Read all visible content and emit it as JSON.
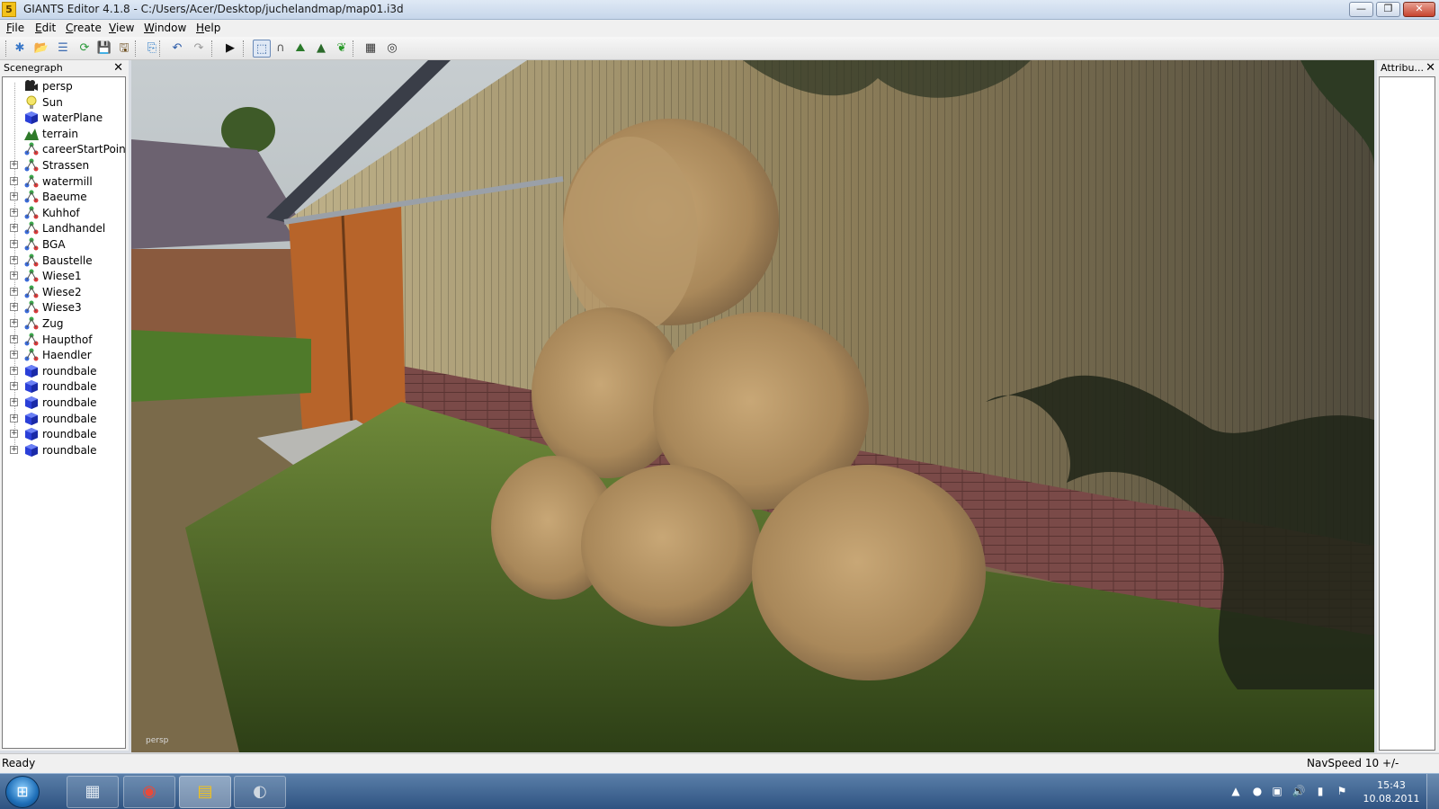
{
  "window": {
    "title": "GIANTS Editor 4.1.8 - C:/Users/Acer/Desktop/juchelandmap/map01.i3d",
    "icon_letter": "5",
    "minimize": "—",
    "maximize": "❐",
    "close": "✕"
  },
  "menu": {
    "items": [
      "File",
      "Edit",
      "Create",
      "View",
      "Window",
      "Help"
    ]
  },
  "toolbar": {
    "buttons": [
      {
        "name": "new-icon",
        "glyph": "✱",
        "color": "#3a78c8"
      },
      {
        "name": "open-icon",
        "glyph": "📂",
        "color": "#c89a2a"
      },
      {
        "name": "list-icon",
        "glyph": "☰",
        "color": "#3a6ab0"
      },
      {
        "name": "reload-icon",
        "glyph": "⟳",
        "color": "#2a9a3a"
      },
      {
        "name": "save-icon",
        "glyph": "💾",
        "color": "#3a3a8a"
      },
      {
        "name": "save-all-icon",
        "glyph": "🖫",
        "color": "#6a4a1a"
      },
      {
        "name": "import-icon",
        "glyph": "⎘",
        "color": "#2a7ac8"
      },
      {
        "name": "undo-icon",
        "glyph": "↶",
        "color": "#2a5aa8"
      },
      {
        "name": "redo-icon",
        "glyph": "↷",
        "color": "#9a9a9a"
      },
      {
        "name": "play-icon",
        "glyph": "▶",
        "color": "#111111"
      },
      {
        "name": "select-mode-icon",
        "glyph": "⬚",
        "color": "#2a5a9a"
      },
      {
        "name": "magnet-icon",
        "glyph": "∩",
        "color": "#555555"
      },
      {
        "name": "terrain-sculpt-icon",
        "glyph": "⛰",
        "color": "#2a7a2a"
      },
      {
        "name": "terrain-paint-icon",
        "glyph": "▲",
        "color": "#2a6a2a"
      },
      {
        "name": "foliage-paint-icon",
        "glyph": "❦",
        "color": "#2a9a2a"
      },
      {
        "name": "render-icon",
        "glyph": "▦",
        "color": "#333333"
      },
      {
        "name": "render-settings-icon",
        "glyph": "◎",
        "color": "#333333"
      }
    ]
  },
  "scenegraph": {
    "title": "Scenegraph",
    "close": "✕",
    "nodes": [
      {
        "label": "persp",
        "icon": "camera-icon",
        "expandable": false
      },
      {
        "label": "Sun",
        "icon": "light-icon",
        "expandable": false
      },
      {
        "label": "waterPlane",
        "icon": "shape-icon",
        "expandable": false
      },
      {
        "label": "terrain",
        "icon": "terrain-icon",
        "expandable": false
      },
      {
        "label": "careerStartPoint",
        "icon": "transform-group-icon",
        "expandable": false
      },
      {
        "label": "Strassen",
        "icon": "transform-group-icon",
        "expandable": true
      },
      {
        "label": "watermill",
        "icon": "transform-group-icon",
        "expandable": true
      },
      {
        "label": "Baeume",
        "icon": "transform-group-icon",
        "expandable": true
      },
      {
        "label": "Kuhhof",
        "icon": "transform-group-icon",
        "expandable": true
      },
      {
        "label": "Landhandel",
        "icon": "transform-group-icon",
        "expandable": true
      },
      {
        "label": "BGA",
        "icon": "transform-group-icon",
        "expandable": true
      },
      {
        "label": "Baustelle",
        "icon": "transform-group-icon",
        "expandable": true
      },
      {
        "label": "Wiese1",
        "icon": "transform-group-icon",
        "expandable": true
      },
      {
        "label": "Wiese2",
        "icon": "transform-group-icon",
        "expandable": true
      },
      {
        "label": "Wiese3",
        "icon": "transform-group-icon",
        "expandable": true
      },
      {
        "label": "Zug",
        "icon": "transform-group-icon",
        "expandable": true
      },
      {
        "label": "Haupthof",
        "icon": "transform-group-icon",
        "expandable": true
      },
      {
        "label": "Haendler",
        "icon": "transform-group-icon",
        "expandable": true
      },
      {
        "label": "roundbale",
        "icon": "shape-icon",
        "expandable": true
      },
      {
        "label": "roundbale",
        "icon": "shape-icon",
        "expandable": true
      },
      {
        "label": "roundbale",
        "icon": "shape-icon",
        "expandable": true
      },
      {
        "label": "roundbale",
        "icon": "shape-icon",
        "expandable": true
      },
      {
        "label": "roundbale",
        "icon": "shape-icon",
        "expandable": true
      },
      {
        "label": "roundbale",
        "icon": "shape-icon",
        "expandable": true
      }
    ]
  },
  "viewport": {
    "camera_label": "persp"
  },
  "attributes": {
    "title": "Attribu...",
    "close": "✕"
  },
  "status": {
    "left": "Ready",
    "right": "NavSpeed 10 +/-"
  },
  "taskbar": {
    "apps": [
      {
        "name": "calculator-icon",
        "glyph": "▦"
      },
      {
        "name": "chrome-icon",
        "glyph": "◉"
      },
      {
        "name": "giants-editor-icon",
        "glyph": "▤"
      },
      {
        "name": "media-app-icon",
        "glyph": "◐"
      }
    ],
    "tray": [
      {
        "name": "tray-expand-icon",
        "glyph": "▲"
      },
      {
        "name": "tray-app-icon",
        "glyph": "●"
      },
      {
        "name": "tray-security-icon",
        "glyph": "▣"
      },
      {
        "name": "volume-icon",
        "glyph": "🔊"
      },
      {
        "name": "network-icon",
        "glyph": "▮"
      },
      {
        "name": "action-center-icon",
        "glyph": "⚑"
      }
    ],
    "time": "15:43",
    "date": "10.08.2011"
  }
}
